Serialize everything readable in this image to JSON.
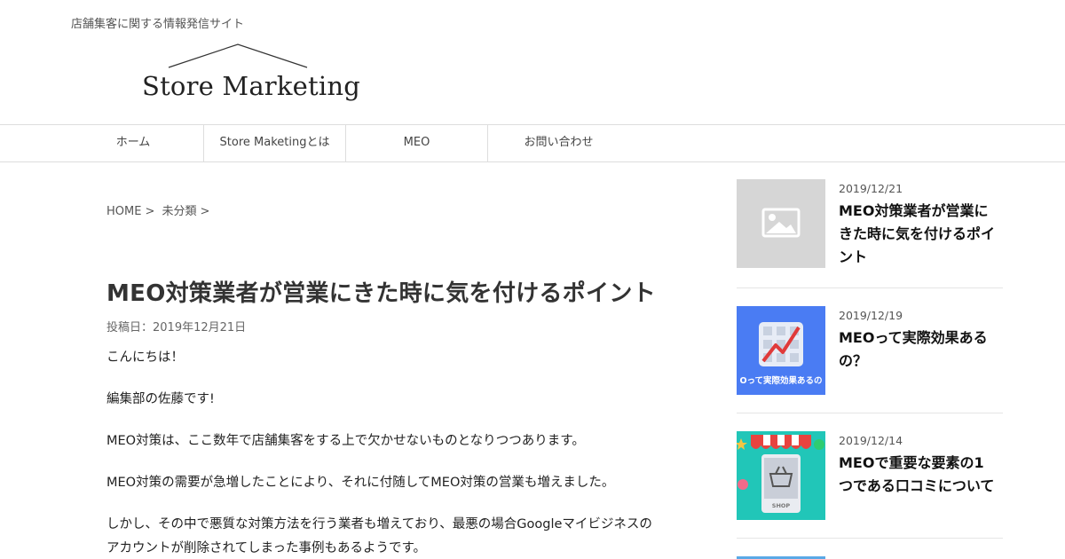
{
  "header": {
    "tagline": "店舗集客に関する情報発信サイト",
    "logo_text": "Store Marketing"
  },
  "nav": {
    "items": [
      {
        "label": "ホーム"
      },
      {
        "label": "Store Maketingとは"
      },
      {
        "label": "MEO"
      },
      {
        "label": "お問い合わせ"
      }
    ]
  },
  "breadcrumb": {
    "home": "HOME",
    "sep": ">",
    "category": "未分類"
  },
  "article": {
    "title": "MEO対策業者が営業にきた時に気を付けるポイント",
    "posted": "投稿日：2019年12月21日",
    "paragraphs": [
      "こんにちは！",
      "編集部の佐藤です!",
      "MEO対策は、ここ数年で店舗集客をする上で欠かせないものとなりつつあります。",
      "MEO対策の需要が急増したことにより、それに付随してMEO対策の営業も増えました。",
      "しかし、その中で悪質な対策方法を行う業者も増えており、最悪の場合Googleマイビジネスの",
      "アカウントが削除されてしまった事例もあるようです。"
    ]
  },
  "sidebar": {
    "posts": [
      {
        "date": "2019/12/21",
        "title": "MEO対策業者が営業にきた時に気を付けるポイント",
        "thumb_icon": "image-placeholder-icon"
      },
      {
        "date": "2019/12/19",
        "title": "MEOって実際効果あるの？",
        "thumb_caption": "Oって実際効果あるの",
        "thumb_icon": "rising-chart-icon"
      },
      {
        "date": "2019/12/14",
        "title": "MEOで重要な要素の1つである口コミについて",
        "thumb_caption": "SHOP",
        "thumb_icon": "shop-basket-icon"
      }
    ]
  },
  "colors": {
    "thumb_placeholder": "#d6d6d6",
    "thumb_blue": "#4a7cf3",
    "thumb_teal": "#21c6b8",
    "awning_red": "#e8433f",
    "nav_border": "#dddddd"
  }
}
